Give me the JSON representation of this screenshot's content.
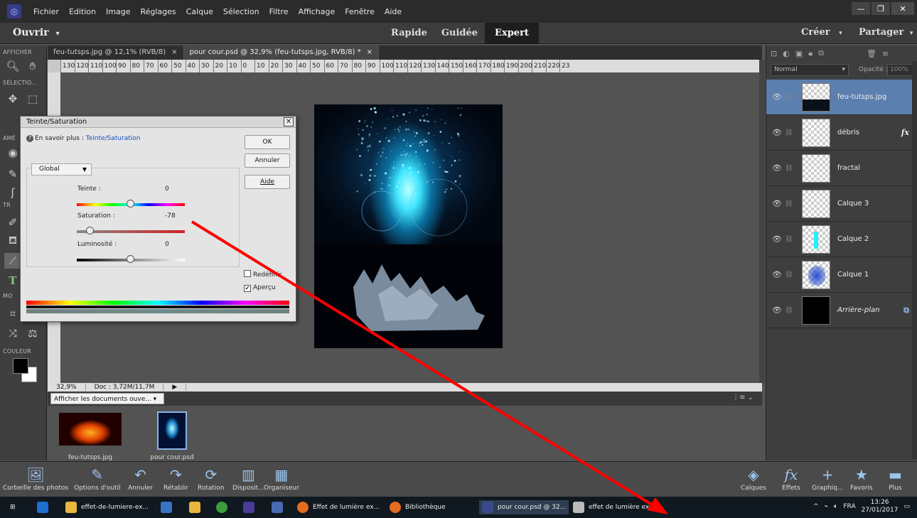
{
  "menu": [
    "Fichier",
    "Edition",
    "Image",
    "Réglages",
    "Calque",
    "Sélection",
    "Filtre",
    "Affichage",
    "Fenêtre",
    "Aide"
  ],
  "modebar": {
    "open": "Ouvrir",
    "modes": [
      "Rapide",
      "Guidée",
      "Expert"
    ],
    "active_mode": "Expert",
    "create": "Créer",
    "share": "Partager"
  },
  "tools": {
    "afficher": "AFFICHER",
    "selection": "SÉLECTIO...",
    "ameliorer": "AMÉ",
    "tracer": "TR",
    "modifier": "MO",
    "couleur": "COULEUR"
  },
  "tabs": [
    {
      "label": "feu-tutsps.jpg @ 12,1% (RVB/8)",
      "active": false
    },
    {
      "label": "pour cour.psd @ 32,9% (feu-tutsps.jpg, RVB/8) *",
      "active": true
    }
  ],
  "ruler_ticks": [
    "130",
    "120",
    "110",
    "100",
    "90",
    "80",
    "70",
    "60",
    "50",
    "40",
    "30",
    "20",
    "10",
    "0",
    "10",
    "20",
    "30",
    "40",
    "50",
    "60",
    "70",
    "80",
    "90",
    "100",
    "110",
    "120",
    "130",
    "140",
    "150",
    "160",
    "170",
    "180",
    "190",
    "200",
    "210",
    "220",
    "23"
  ],
  "status": {
    "zoom": "32,9%",
    "doc": "Doc : 3,72M/11,7M"
  },
  "bin": {
    "select": "Afficher les documents ouve...",
    "thumbs": [
      {
        "label": "feu-tutsps.jpg"
      },
      {
        "label": "pour cour.psd"
      }
    ]
  },
  "layers": {
    "blend": "Normal",
    "opacity_label": "Opacité :",
    "opacity": "100%",
    "items": [
      {
        "name": "feu-tutsps.jpg",
        "active": true,
        "fx": ""
      },
      {
        "name": "débris",
        "active": false,
        "fx": "fx"
      },
      {
        "name": "fractal",
        "active": false,
        "fx": ""
      },
      {
        "name": "Calque 3",
        "active": false,
        "fx": ""
      },
      {
        "name": "Calque 2",
        "active": false,
        "fx": ""
      },
      {
        "name": "Calque 1",
        "active": false,
        "fx": ""
      },
      {
        "name": "Arrière-plan",
        "active": false,
        "fx": ""
      }
    ]
  },
  "dialog": {
    "title": "Teinte/Saturation",
    "learn_prefix": "En savoir plus :",
    "learn_link": "Teinte/Saturation",
    "ok": "OK",
    "cancel": "Annuler",
    "help": "Aide",
    "channel": "Global",
    "hue_label": "Teinte :",
    "hue_value": "0",
    "sat_label": "Saturation :",
    "sat_value": "-78",
    "light_label": "Luminosité :",
    "light_value": "0",
    "colorize": "Redéfinir",
    "preview": "Aperçu"
  },
  "bottom": [
    "Corbeille des photos",
    "Options d'outil",
    "Annuler",
    "Rétablir",
    "Rotation",
    "Disposit...",
    "Organiseur",
    "Calques",
    "Effets",
    "Graphiq...",
    "Favoris",
    "Plus"
  ],
  "taskbar": {
    "items": [
      "effet-de-lumiere-ex...",
      "Effet de lumière ex...",
      "Bibliothèque",
      "pour cour.psd @ 32...",
      "effet de lumière ex..."
    ],
    "lang": "FRA",
    "time": "13:26",
    "date": "27/01/2017"
  },
  "colors": {
    "accent": "#5b7fae",
    "arrow": "#ff0000"
  }
}
